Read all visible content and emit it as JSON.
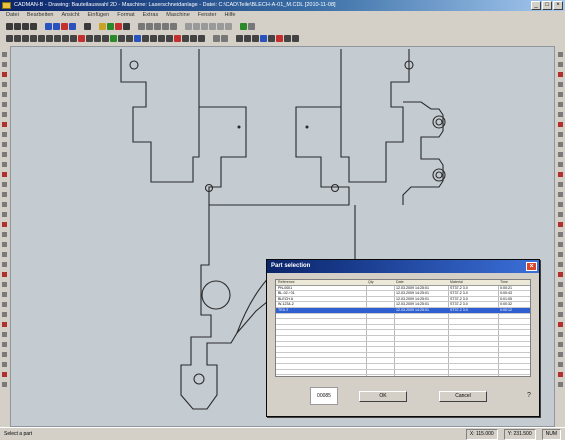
{
  "window": {
    "title": "CADMAN-B - Drawing: Bauteilauswahl 2D - Maschine: Laserschneidanlage - Datei: C:\\CAD\\Teile\\BLECH-A-01_M.CDL [2010-11-08]",
    "controls": {
      "minimize": "_",
      "maximize": "□",
      "close": "×"
    }
  },
  "menu": [
    "Datei",
    "Bearbeiten",
    "Ansicht",
    "Einfügen",
    "Format",
    "Extras",
    "Maschine",
    "Fenster",
    "Hilfe"
  ],
  "dialog": {
    "title": "Part selection",
    "close_label": "×",
    "columns": [
      "Reference",
      "Qty",
      "Date",
      "Material",
      "Time"
    ],
    "rows": [
      {
        "ref": "PN-0001",
        "qty": "",
        "date": "12.03.2009 14:25:01",
        "mat": "ST37-2 3.0",
        "time": "0:00:21"
      },
      {
        "ref": "BL-02 / 01",
        "qty": "",
        "date": "12.03.2009 14:25:01",
        "mat": "ST37-2 3.0",
        "time": "0:00:43"
      },
      {
        "ref": "BLECH A",
        "qty": "",
        "date": "12.03.2009 14:25:01",
        "mat": "ST37-2 3.0",
        "time": "0:01:05"
      },
      {
        "ref": "W-1234-2",
        "qty": "",
        "date": "12.03.2009 14:25:01",
        "mat": "ST37-2 3.0",
        "time": "0:00:32"
      },
      {
        "ref": "TEIL 5",
        "qty": "",
        "date": "12.03.2009 14:25:01",
        "mat": "ST37-2 3.0",
        "time": "0:00:12"
      },
      {
        "ref": "",
        "qty": "",
        "date": "",
        "mat": "",
        "time": ""
      },
      {
        "ref": "",
        "qty": "",
        "date": "",
        "mat": "",
        "time": ""
      },
      {
        "ref": "",
        "qty": "",
        "date": "",
        "mat": "",
        "time": ""
      },
      {
        "ref": "",
        "qty": "",
        "date": "",
        "mat": "",
        "time": ""
      },
      {
        "ref": "",
        "qty": "",
        "date": "",
        "mat": "",
        "time": ""
      },
      {
        "ref": "",
        "qty": "",
        "date": "",
        "mat": "",
        "time": ""
      },
      {
        "ref": "",
        "qty": "",
        "date": "",
        "mat": "",
        "time": ""
      },
      {
        "ref": "",
        "qty": "",
        "date": "",
        "mat": "",
        "time": ""
      },
      {
        "ref": "",
        "qty": "",
        "date": "",
        "mat": "",
        "time": ""
      },
      {
        "ref": "",
        "qty": "",
        "date": "",
        "mat": "",
        "time": ""
      },
      {
        "ref": "",
        "qty": "",
        "date": "",
        "mat": "",
        "time": ""
      }
    ],
    "preview_label": "00085",
    "ok_label": "OK",
    "cancel_label": "Cancel",
    "help_label": "?"
  },
  "status": {
    "left": "Select a part",
    "coords": "X: 115.000",
    "coords2": "Y: 231.500",
    "zoom": "NUM"
  },
  "colors": {
    "canvas_bg": "#c4cbd1",
    "drawing_line": "#2a2a2a",
    "dialog_title": "#0a246a",
    "selection": "#2f5fd0"
  }
}
